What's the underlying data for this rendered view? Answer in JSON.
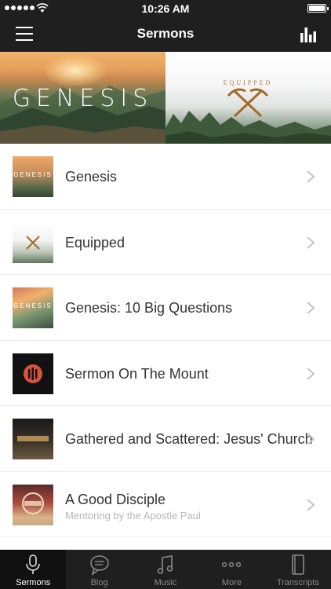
{
  "status": {
    "time": "10:26 AM"
  },
  "nav": {
    "title": "Sermons",
    "menu_icon": "hamburger-menu-icon",
    "stats_icon": "bar-chart-icon"
  },
  "hero": [
    {
      "title": "GENESIS"
    },
    {
      "title": "EQUIPPED"
    }
  ],
  "sermons": [
    {
      "title": "Genesis",
      "subtitle": ""
    },
    {
      "title": "Equipped",
      "subtitle": ""
    },
    {
      "title": "Genesis: 10 Big Questions",
      "subtitle": ""
    },
    {
      "title": "Sermon On The Mount",
      "subtitle": ""
    },
    {
      "title": "Gathered and Scattered: Jesus' Church",
      "subtitle": ""
    },
    {
      "title": "A Good Disciple",
      "subtitle": "Mentoring by the Apostle Paul"
    }
  ],
  "tabs": [
    {
      "label": "Sermons",
      "icon": "microphone-icon",
      "active": true
    },
    {
      "label": "Blog",
      "icon": "speech-bubble-icon",
      "active": false
    },
    {
      "label": "Music",
      "icon": "music-note-icon",
      "active": false
    },
    {
      "label": "More",
      "icon": "more-dots-icon",
      "active": false
    },
    {
      "label": "Transcripts",
      "icon": "book-icon",
      "active": false
    }
  ],
  "colors": {
    "bar": "#1f1f1f",
    "active_tab": "#111111",
    "inactive_tab_text": "#8a8a8a"
  }
}
